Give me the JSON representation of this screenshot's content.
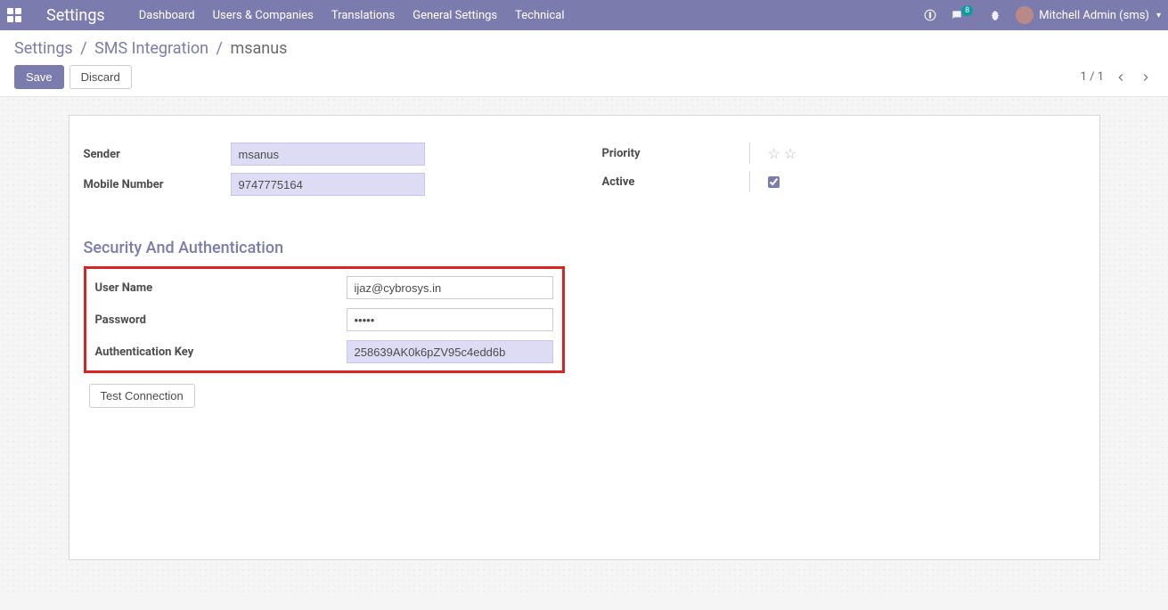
{
  "navbar": {
    "brand": "Settings",
    "links": [
      "Dashboard",
      "Users & Companies",
      "Translations",
      "General Settings",
      "Technical"
    ],
    "messages_count": "8",
    "user_name": "Mitchell Admin (sms)"
  },
  "breadcrumb": {
    "root": "Settings",
    "parent": "SMS Integration",
    "current": "msanus"
  },
  "buttons": {
    "save": "Save",
    "discard": "Discard",
    "test_connection": "Test Connection"
  },
  "pager": {
    "current": "1",
    "total": "1"
  },
  "form": {
    "labels": {
      "sender": "Sender",
      "mobile_number": "Mobile Number",
      "priority": "Priority",
      "active": "Active",
      "user_name": "User Name",
      "password": "Password",
      "auth_key": "Authentication Key"
    },
    "values": {
      "sender": "msanus",
      "mobile_number": "9747775164",
      "user_name": "ijaz@cybrosys.in",
      "password": "•••••",
      "auth_key": "258639AK0k6pZV95c4edd6b",
      "active": true
    },
    "section_title": "Security And Authentication"
  },
  "colors": {
    "primary": "#7c7bad",
    "highlight_bg": "#dedcf5",
    "annotation_red": "#d92424"
  }
}
